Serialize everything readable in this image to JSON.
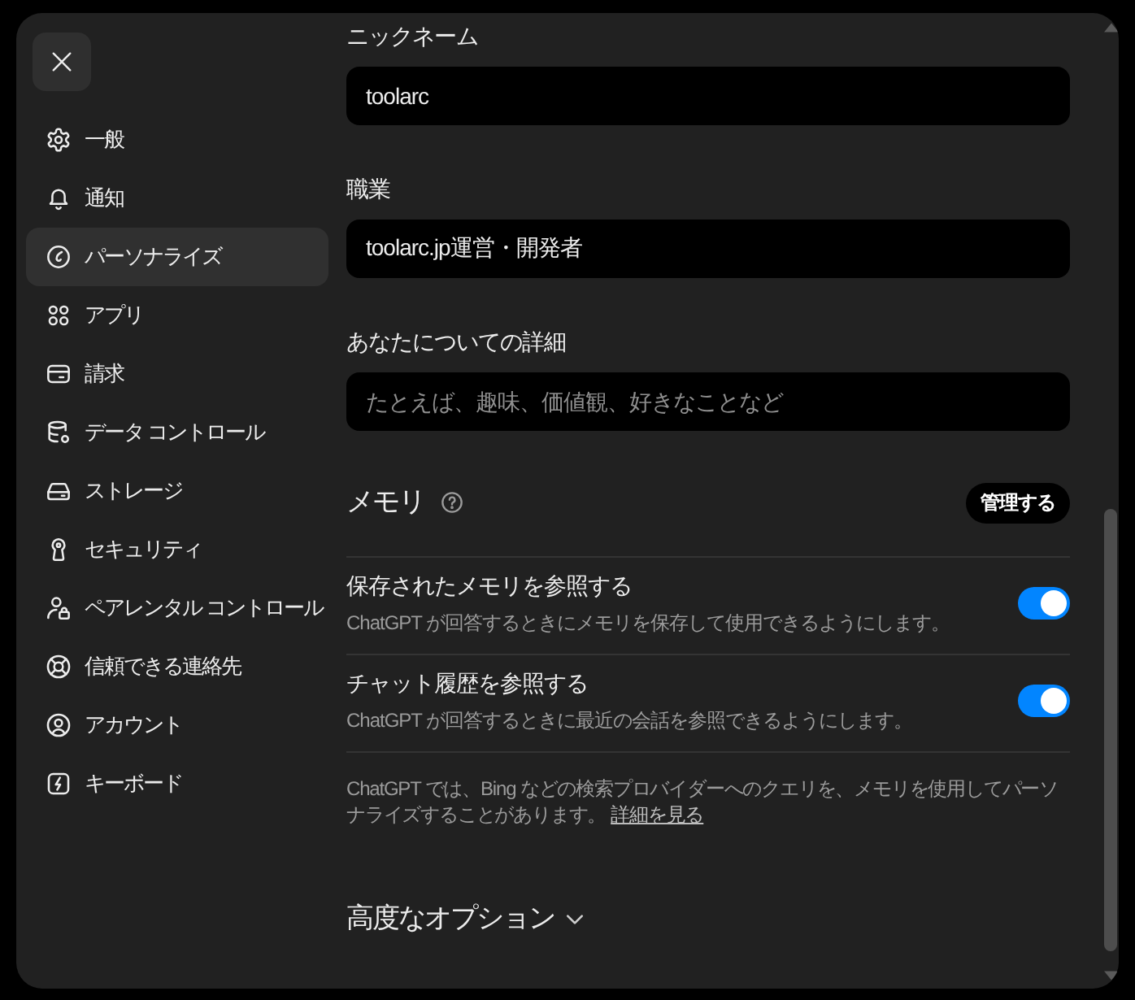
{
  "sidebar": {
    "items": [
      {
        "label": "一般",
        "selected": false
      },
      {
        "label": "通知",
        "selected": false
      },
      {
        "label": "パーソナライズ",
        "selected": true
      },
      {
        "label": "アプリ",
        "selected": false
      },
      {
        "label": "請求",
        "selected": false
      },
      {
        "label": "データ コントロール",
        "selected": false
      },
      {
        "label": "ストレージ",
        "selected": false
      },
      {
        "label": "セキュリティ",
        "selected": false
      },
      {
        "label": "ペアレンタル コントロール",
        "selected": false
      },
      {
        "label": "信頼できる連絡先",
        "selected": false
      },
      {
        "label": "アカウント",
        "selected": false
      },
      {
        "label": "キーボード",
        "selected": false
      }
    ]
  },
  "profile": {
    "fields": [
      {
        "label": "ニックネーム",
        "value": "toolarc"
      },
      {
        "label": "職業",
        "value": "toolarc.jp運営・開発者"
      },
      {
        "label": "あなたについての詳細",
        "placeholder": "たとえば、趣味、価値観、好きなことなど"
      }
    ]
  },
  "memory": {
    "title": "メモリ",
    "manage_button": "管理する",
    "settings": [
      {
        "title": "保存されたメモリを参照する",
        "description": "ChatGPT が回答するときにメモリを保存して使用できるようにします。",
        "on": true
      },
      {
        "title": "チャット履歴を参照する",
        "description": "ChatGPT が回答するときに最近の会話を参照できるようにします。",
        "on": true
      }
    ],
    "note": "ChatGPT では、Bing などの検索プロバイダーへのクエリを、メモリを使用してパーソナライズすることがあります。",
    "note_link": "詳細を見る"
  },
  "advanced_options": {
    "label": "高度なオプション",
    "expanded": false
  }
}
